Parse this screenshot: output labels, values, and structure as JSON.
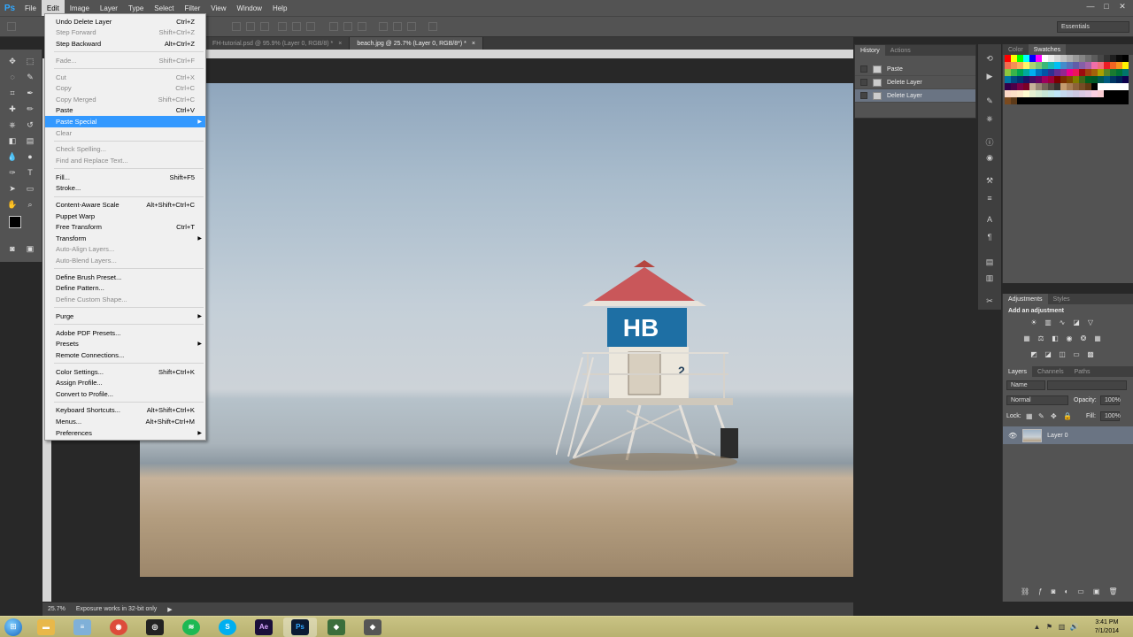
{
  "app": {
    "logo": "Ps"
  },
  "menubar": {
    "items": [
      "File",
      "Edit",
      "Image",
      "Layer",
      "Type",
      "Select",
      "Filter",
      "View",
      "Window",
      "Help"
    ]
  },
  "window_controls": {
    "minimize": "—",
    "maximize": "□",
    "close": "✕"
  },
  "options": {
    "workspace": "Essentials"
  },
  "tabs": [
    {
      "label": "FH-tutorial.psd @ 95.9% (Layer 0, RGB/8) *",
      "close": "×"
    },
    {
      "label": "beach.jpg @ 25.7% (Layer 0, RGB/8*) *",
      "close": "×"
    }
  ],
  "edit_menu": {
    "items": [
      {
        "label": "Undo Delete Layer",
        "shortcut": "Ctrl+Z",
        "enabled": true
      },
      {
        "label": "Step Forward",
        "shortcut": "Shift+Ctrl+Z",
        "enabled": false
      },
      {
        "label": "Step Backward",
        "shortcut": "Alt+Ctrl+Z",
        "enabled": true
      },
      {
        "sep": true
      },
      {
        "label": "Fade...",
        "shortcut": "Shift+Ctrl+F",
        "enabled": false
      },
      {
        "sep": true
      },
      {
        "label": "Cut",
        "shortcut": "Ctrl+X",
        "enabled": false
      },
      {
        "label": "Copy",
        "shortcut": "Ctrl+C",
        "enabled": false
      },
      {
        "label": "Copy Merged",
        "shortcut": "Shift+Ctrl+C",
        "enabled": false
      },
      {
        "label": "Paste",
        "shortcut": "Ctrl+V",
        "enabled": true
      },
      {
        "label": "Paste Special",
        "shortcut": "",
        "enabled": true,
        "submenu": true,
        "highlighted": true
      },
      {
        "label": "Clear",
        "shortcut": "",
        "enabled": false
      },
      {
        "sep": true
      },
      {
        "label": "Check Spelling...",
        "shortcut": "",
        "enabled": false
      },
      {
        "label": "Find and Replace Text...",
        "shortcut": "",
        "enabled": false
      },
      {
        "sep": true
      },
      {
        "label": "Fill...",
        "shortcut": "Shift+F5",
        "enabled": true
      },
      {
        "label": "Stroke...",
        "shortcut": "",
        "enabled": true
      },
      {
        "sep": true
      },
      {
        "label": "Content-Aware Scale",
        "shortcut": "Alt+Shift+Ctrl+C",
        "enabled": true
      },
      {
        "label": "Puppet Warp",
        "shortcut": "",
        "enabled": true
      },
      {
        "label": "Free Transform",
        "shortcut": "Ctrl+T",
        "enabled": true
      },
      {
        "label": "Transform",
        "shortcut": "",
        "enabled": true,
        "submenu": true
      },
      {
        "label": "Auto-Align Layers...",
        "shortcut": "",
        "enabled": false
      },
      {
        "label": "Auto-Blend Layers...",
        "shortcut": "",
        "enabled": false
      },
      {
        "sep": true
      },
      {
        "label": "Define Brush Preset...",
        "shortcut": "",
        "enabled": true
      },
      {
        "label": "Define Pattern...",
        "shortcut": "",
        "enabled": true
      },
      {
        "label": "Define Custom Shape...",
        "shortcut": "",
        "enabled": false
      },
      {
        "sep": true
      },
      {
        "label": "Purge",
        "shortcut": "",
        "enabled": true,
        "submenu": true
      },
      {
        "sep": true
      },
      {
        "label": "Adobe PDF Presets...",
        "shortcut": "",
        "enabled": true
      },
      {
        "label": "Presets",
        "shortcut": "",
        "enabled": true,
        "submenu": true
      },
      {
        "label": "Remote Connections...",
        "shortcut": "",
        "enabled": true
      },
      {
        "sep": true
      },
      {
        "label": "Color Settings...",
        "shortcut": "Shift+Ctrl+K",
        "enabled": true
      },
      {
        "label": "Assign Profile...",
        "shortcut": "",
        "enabled": true
      },
      {
        "label": "Convert to Profile...",
        "shortcut": "",
        "enabled": true
      },
      {
        "sep": true
      },
      {
        "label": "Keyboard Shortcuts...",
        "shortcut": "Alt+Shift+Ctrl+K",
        "enabled": true
      },
      {
        "label": "Menus...",
        "shortcut": "Alt+Shift+Ctrl+M",
        "enabled": true
      },
      {
        "label": "Preferences",
        "shortcut": "",
        "enabled": true,
        "submenu": true
      }
    ]
  },
  "history": {
    "tabs": [
      "History",
      "Actions"
    ],
    "items": [
      {
        "label": "Paste",
        "selected": false
      },
      {
        "label": "Delete Layer",
        "selected": false
      },
      {
        "label": "Delete Layer",
        "selected": true
      }
    ]
  },
  "swatches": {
    "tabs": [
      "Color",
      "Swatches"
    ],
    "colors": [
      "#ff0000",
      "#ffff00",
      "#00ff00",
      "#00ffff",
      "#0000ff",
      "#ff00ff",
      "#ffffff",
      "#ebebeb",
      "#d6d6d6",
      "#c2c2c2",
      "#adadad",
      "#999999",
      "#858585",
      "#707070",
      "#5c5c5c",
      "#474747",
      "#333333",
      "#1f1f1f",
      "#0a0a0a",
      "#000000",
      "#f26c4f",
      "#f68e55",
      "#fbaf5c",
      "#fff467",
      "#acd372",
      "#7cc576",
      "#3bb878",
      "#1abbb4",
      "#00bff3",
      "#438ccb",
      "#5574b9",
      "#605ca8",
      "#855fa8",
      "#a763a8",
      "#f06ea9",
      "#f26d7d",
      "#ed1c24",
      "#f26522",
      "#f7941d",
      "#fff200",
      "#8dc63f",
      "#39b54a",
      "#00a651",
      "#00a99d",
      "#00aeef",
      "#0072bc",
      "#0054a6",
      "#2e3192",
      "#662d91",
      "#92278f",
      "#ec008c",
      "#ed145b",
      "#9e0b0f",
      "#a0410d",
      "#a3620a",
      "#aba000",
      "#598527",
      "#197b30",
      "#007236",
      "#00746b",
      "#0076a3",
      "#004a80",
      "#003471",
      "#1b1464",
      "#440e62",
      "#630460",
      "#9e005d",
      "#9e0039",
      "#790000",
      "#7b2e00",
      "#7d4900",
      "#827b00",
      "#406618",
      "#005e20",
      "#005826",
      "#005952",
      "#005b7f",
      "#003663",
      "#002157",
      "#0d004c",
      "#32004b",
      "#4b0049",
      "#7b0046",
      "#7a0026",
      "#c7b299",
      "#998675",
      "#736357",
      "#534741",
      "#37302d",
      "#c69c6d",
      "#a67c52",
      "#8c6239",
      "#754c24",
      "#603913",
      "#000000",
      "#ffffff",
      "#ffffff",
      "#ffffff",
      "#ffffff",
      "#ffffff",
      "#fdd9c8",
      "#fde0c7",
      "#fee8c9",
      "#fffbd0",
      "#e5efd1",
      "#d5ebd3",
      "#c7e6d6",
      "#c1e7e6",
      "#bfe6f7",
      "#c4d8ee",
      "#c8d0e8",
      "#ccc8e2",
      "#d8c8e2",
      "#e3c9e2",
      "#fbcfe1",
      "#fbcdd3",
      "#000000",
      "#000000",
      "#000000",
      "#000000",
      "#7b4a1f",
      "#5c3a19",
      "#000000",
      "#000000",
      "#000000",
      "#000000",
      "#000000",
      "#000000",
      "#000000",
      "#000000",
      "#000000",
      "#000000",
      "#000000",
      "#000000",
      "#000000",
      "#000000",
      "#000000",
      "#000000",
      "#000000",
      "#000000"
    ]
  },
  "adjustments": {
    "tabs": [
      "Adjustments",
      "Styles"
    ],
    "title": "Add an adjustment"
  },
  "layers": {
    "tabs": [
      "Layers",
      "Channels",
      "Paths"
    ],
    "filter_kind": "Name",
    "blend_mode": "Normal",
    "opacity_label": "Opacity:",
    "opacity_value": "100%",
    "lock_label": "Lock:",
    "fill_label": "Fill:",
    "fill_value": "100%",
    "layer_name": "Layer 0"
  },
  "status": {
    "zoom": "25.7%",
    "message": "Exposure works in 32-bit only"
  },
  "taskbar": {
    "time": "3:41 PM",
    "date": "7/1/2014",
    "apps": [
      "Explorer",
      "Notepad",
      "Chrome",
      "Steam",
      "Spotify",
      "Skype",
      "After Effects",
      "Photoshop",
      "App",
      "App"
    ]
  },
  "photo": {
    "tower_letters": "HB",
    "tower_number": "2"
  }
}
